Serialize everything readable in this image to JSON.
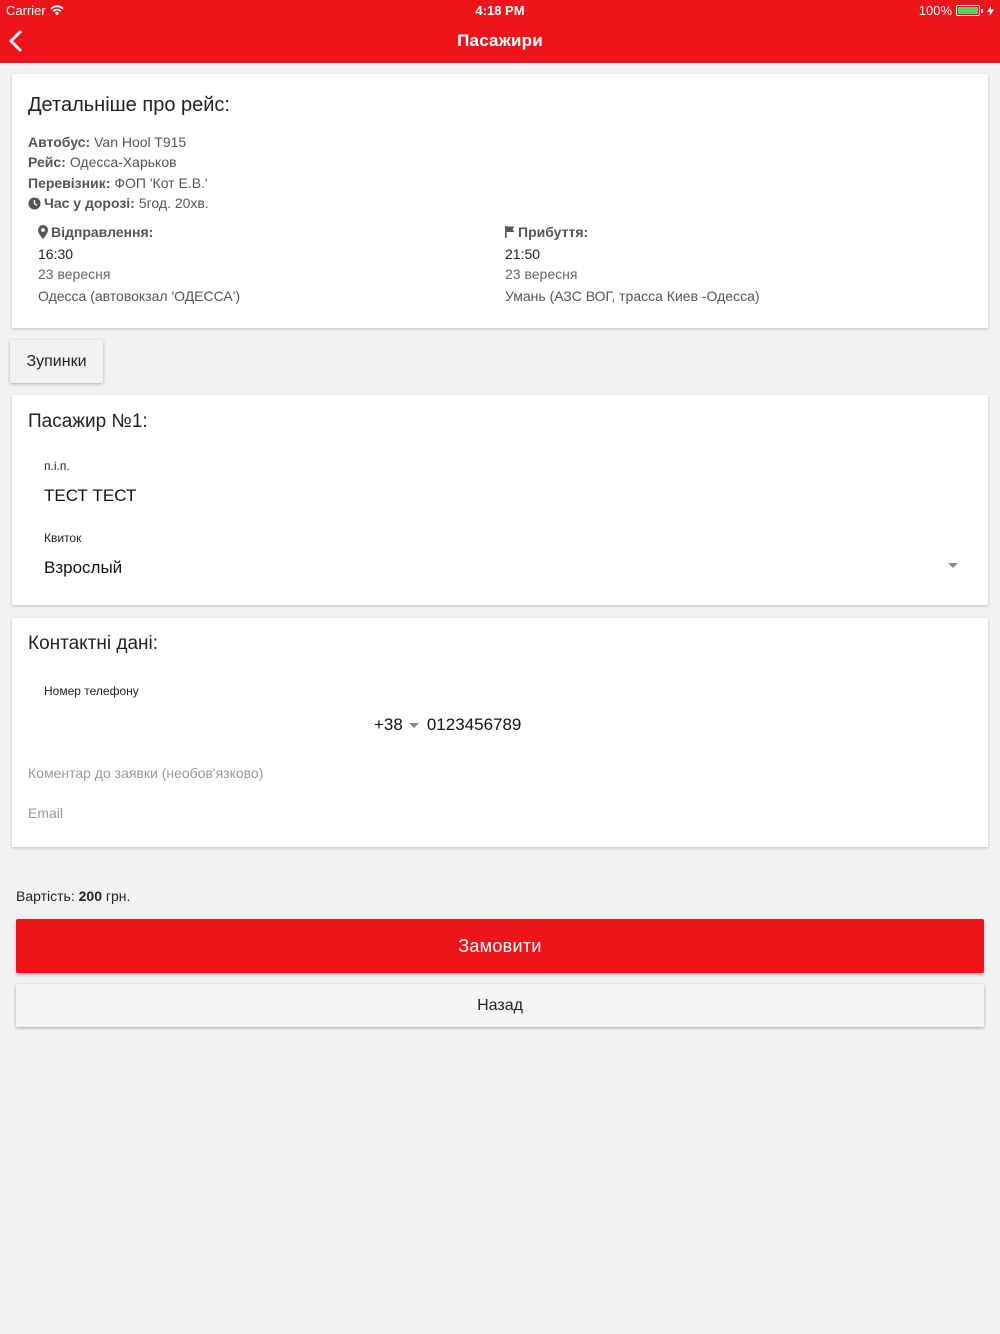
{
  "status_bar": {
    "carrier": "Carrier",
    "time": "4:18 PM",
    "battery": "100%"
  },
  "nav": {
    "title": "Пасажири"
  },
  "trip": {
    "title": "Детальніше про рейс:",
    "bus_label": "Автобус:",
    "bus_value": "Van Hool T915",
    "route_label": "Рейс:",
    "route_value": "Одесса-Харьков",
    "carrier_label": "Перевізник:",
    "carrier_value": "ФОП 'Кот Е.В.'",
    "duration_label": "Час у дорозі:",
    "duration_value": "5год. 20хв.",
    "departure": {
      "label": "Відправлення:",
      "time": "16:30",
      "date": "23 вересня",
      "place": "Одесса (автовокзал 'ОДЕССА')"
    },
    "arrival": {
      "label": "Прибуття:",
      "time": "21:50",
      "date": "23 вересня",
      "place": "Умань (АЗС ВОГ, трасса Киев -Одесса)"
    }
  },
  "stops_button": "Зупинки",
  "passenger": {
    "title": "Пасажир №1:",
    "name_label": "п.і.п.",
    "name_value": "ТЕСТ ТЕСТ",
    "ticket_label": "Квиток",
    "ticket_value": "Взрослый"
  },
  "contacts": {
    "title": "Контактні дані:",
    "phone_label": "Номер телефону",
    "phone_code": "+38",
    "phone_number": "0123456789",
    "comment_placeholder": "Коментар до заявки (необов'язково)",
    "email_placeholder": "Email"
  },
  "price": {
    "label": "Вартість:",
    "amount": "200",
    "currency": "грн."
  },
  "order_button": "Замовити",
  "back_button": "Назад",
  "colors": {
    "accent": "#ee141b",
    "background": "#f2f2f2"
  }
}
